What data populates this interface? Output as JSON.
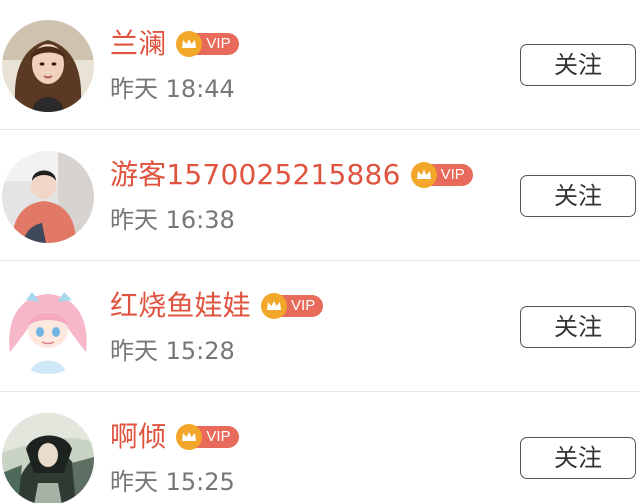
{
  "users": [
    {
      "name": "兰澜",
      "vip_label": "VIP",
      "time": "昨天 18:44",
      "follow_label": "关注",
      "avatar_icon": "woman-portrait-avatar"
    },
    {
      "name": "游客1570025215886",
      "vip_label": "VIP",
      "time": "昨天 16:38",
      "follow_label": "关注",
      "avatar_icon": "girl-photo-avatar"
    },
    {
      "name": "红烧鱼娃娃",
      "vip_label": "VIP",
      "time": "昨天 15:28",
      "follow_label": "关注",
      "avatar_icon": "anime-girl-avatar"
    },
    {
      "name": "啊倾",
      "vip_label": "VIP",
      "time": "昨天 15:25",
      "follow_label": "关注",
      "avatar_icon": "illustration-avatar"
    }
  ],
  "colors": {
    "name": "#e0533e",
    "vip_tag": "#e86a5a",
    "vip_crown": "#f2a72b",
    "time": "#777777",
    "divider": "#e6e6e6"
  }
}
